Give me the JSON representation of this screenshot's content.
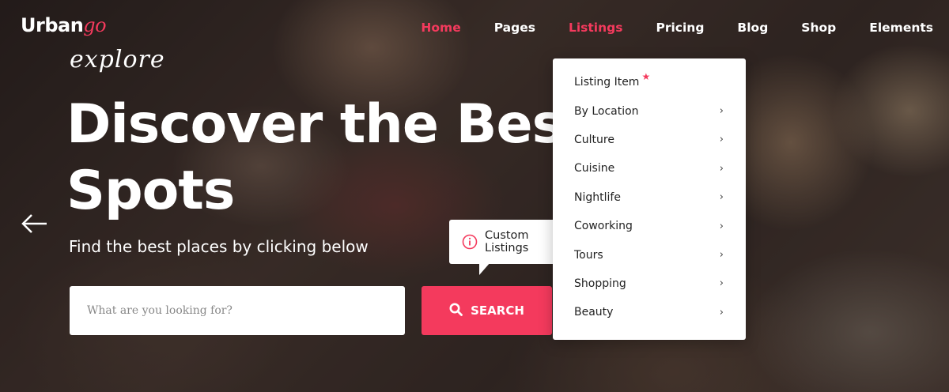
{
  "brand": {
    "name_main": "Urban",
    "name_accent": "go",
    "accent_color": "#f43a5d"
  },
  "nav": {
    "items": [
      {
        "label": "Home",
        "active": true
      },
      {
        "label": "Pages",
        "active": false
      },
      {
        "label": "Listings",
        "active": true
      },
      {
        "label": "Pricing",
        "active": false
      },
      {
        "label": "Blog",
        "active": false
      },
      {
        "label": "Shop",
        "active": false
      },
      {
        "label": "Elements",
        "active": false
      }
    ]
  },
  "hero": {
    "script": "explore",
    "headline_line1": "Discover the Best",
    "headline_line2": "Spots",
    "subtitle": "Find the best places by clicking below",
    "prev_icon": "arrow-left-icon"
  },
  "search": {
    "placeholder": "What are you looking for?",
    "button_label": "SEARCH",
    "button_icon": "search-icon"
  },
  "tooltip": {
    "text": "Custom Listings",
    "icon": "info-icon"
  },
  "listings_menu": {
    "items": [
      {
        "label": "Listing Item",
        "badge": "★",
        "has_submenu": false
      },
      {
        "label": "By Location",
        "has_submenu": true
      },
      {
        "label": "Culture",
        "has_submenu": true
      },
      {
        "label": "Cuisine",
        "has_submenu": true
      },
      {
        "label": "Nightlife",
        "has_submenu": true
      },
      {
        "label": "Coworking",
        "has_submenu": true
      },
      {
        "label": "Tours",
        "has_submenu": true
      },
      {
        "label": "Shopping",
        "has_submenu": true
      },
      {
        "label": "Beauty",
        "has_submenu": true
      }
    ],
    "chevron": "›"
  }
}
